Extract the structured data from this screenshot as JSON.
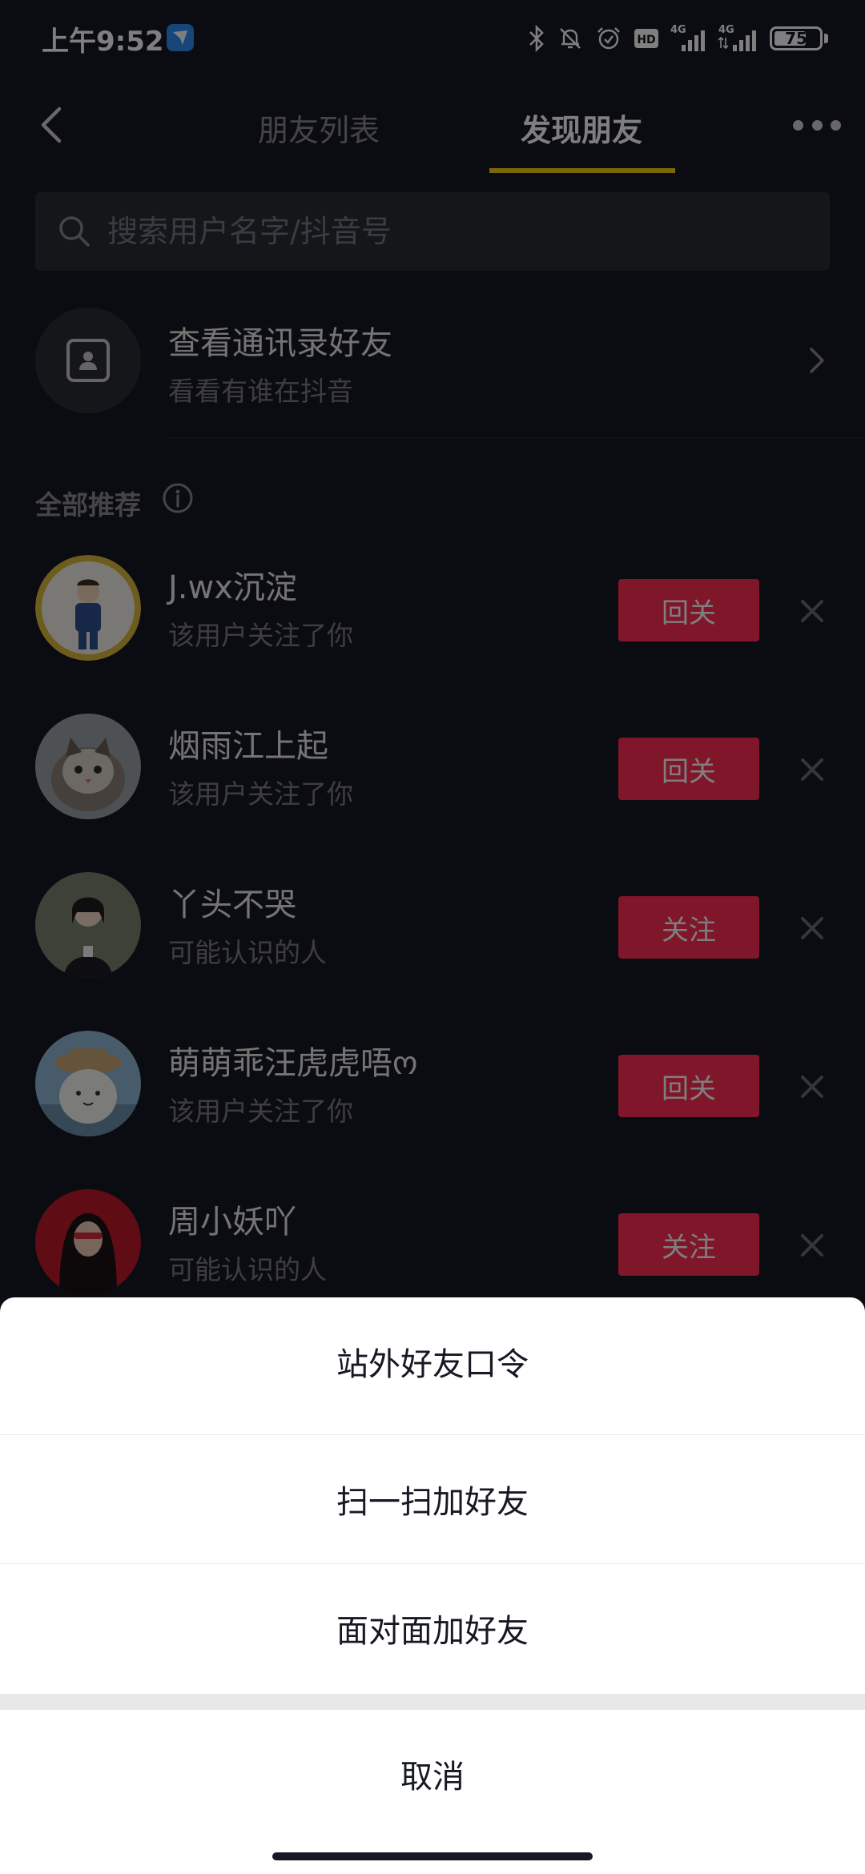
{
  "status_bar": {
    "time": "上午9:52",
    "network_1": "4G",
    "network_2": "4G",
    "hd_label": "HD",
    "battery_level": 75,
    "icons": [
      "app-notification-icon",
      "bluetooth-icon",
      "mute-bell-icon",
      "alarm-icon",
      "hd-icon",
      "signal-icon",
      "signal-icon",
      "battery-icon"
    ]
  },
  "nav": {
    "tabs": [
      {
        "label": "朋友列表",
        "active": false
      },
      {
        "label": "发现朋友",
        "active": true
      }
    ],
    "accent_color": "#face15"
  },
  "search": {
    "placeholder": "搜索用户名字/抖音号"
  },
  "contacts_entry": {
    "title": "查看通讯录好友",
    "subtitle": "看看有谁在抖音"
  },
  "section": {
    "title": "全部推荐"
  },
  "users": [
    {
      "name": "J.wx沉淀",
      "subtitle": "该用户关注了你",
      "button": "回关"
    },
    {
      "name": "烟雨江上起",
      "subtitle": "该用户关注了你",
      "button": "回关"
    },
    {
      "name": "丫头不哭",
      "subtitle": "可能认识的人",
      "button": "关注"
    },
    {
      "name": "萌萌乖汪虎虎唔ო",
      "subtitle": "该用户关注了你",
      "button": "回关"
    },
    {
      "name": "周小妖吖",
      "subtitle": "可能认识的人",
      "button": "关注"
    }
  ],
  "follow_color": "#fe2c55",
  "action_sheet": {
    "items": [
      "站外好友口令",
      "扫一扫加好友",
      "面对面加好友"
    ],
    "cancel": "取消"
  }
}
